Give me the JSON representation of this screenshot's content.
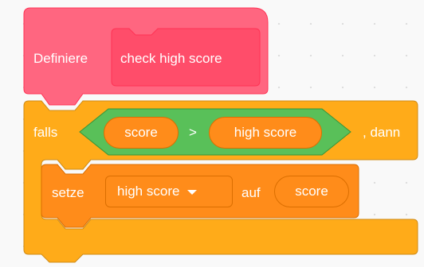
{
  "define_block": {
    "keyword": "Definiere",
    "name": "check high score",
    "color": "#ff6680",
    "inner_color": "#ff4d6a"
  },
  "if_block": {
    "keyword_if": "falls",
    "keyword_then": ", dann",
    "color": "#ffab19",
    "condition": {
      "operator": ">",
      "left": "score",
      "right": "high score",
      "color": "#59c059"
    }
  },
  "set_block": {
    "keyword": "setze",
    "variable": "high score",
    "dropdown_icon": "caret-down-icon",
    "keyword_to": "auf",
    "value": "score",
    "color": "#ff8c1a"
  }
}
